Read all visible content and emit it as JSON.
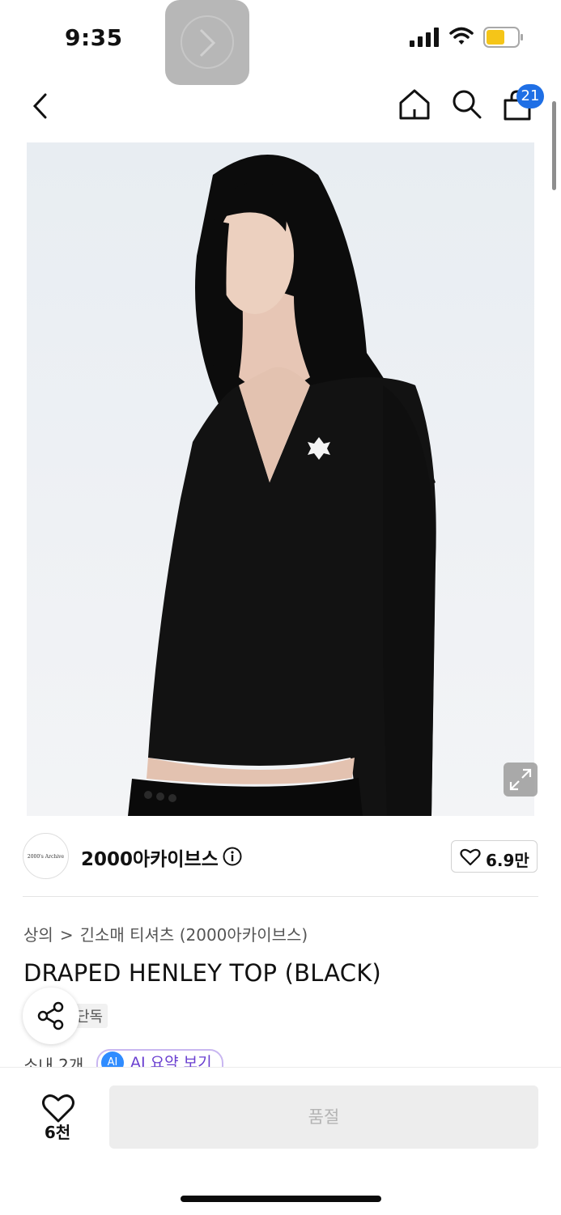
{
  "status_bar": {
    "time": "9:35"
  },
  "nav": {
    "back_icon": "chevron-left-icon",
    "home_icon": "home-icon",
    "search_icon": "search-icon",
    "cart_icon": "cart-icon",
    "cart_count": "21"
  },
  "product_image": {
    "alt": "product photo",
    "expand_icon": "expand-icon"
  },
  "seller": {
    "logo_text": "2000's Archive",
    "name": "2000아카이브스",
    "info_icon": "info-icon",
    "likes": "6.9만"
  },
  "breadcrumb": {
    "items": [
      "상의",
      "긴소매 티셔츠 (2000아카이브스)"
    ],
    "separator": ">"
  },
  "product": {
    "title": "DRAPED HENLEY TOP (BLACK)",
    "tag": "단독",
    "shipping_partial": "소내 2개",
    "ai_summary_label": "AI 요약 보기",
    "ai_badge": "AI"
  },
  "bottom_bar": {
    "wish_icon": "heart-icon",
    "wish_count": "6천",
    "sold_out_label": "품절"
  },
  "colors": {
    "accent": "#1f6fe5",
    "ai_purple": "#6a3fd0",
    "disabled_bg": "#ededed"
  }
}
